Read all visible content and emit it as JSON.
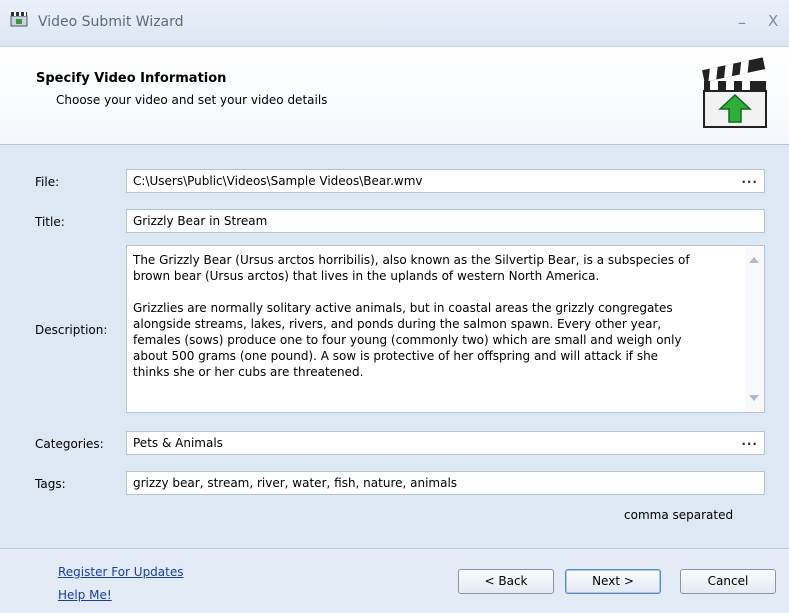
{
  "window": {
    "title": "Video Submit Wizard",
    "minimize": "–",
    "close": "X"
  },
  "header": {
    "title": "Specify Video Information",
    "subtitle": "Choose your video and set your video details"
  },
  "form": {
    "file": {
      "label": "File:",
      "value": "C:\\Users\\Public\\Videos\\Sample Videos\\Bear.wmv",
      "browse": "..."
    },
    "title": {
      "label": "Title:",
      "value": "Grizzly Bear in Stream"
    },
    "description": {
      "label": "Description:",
      "value": "The Grizzly Bear (Ursus arctos horribilis), also known as the Silvertip Bear, is a subspecies of\nbrown bear (Ursus arctos) that lives in the uplands of western North America.\n\nGrizzlies are normally solitary active animals, but in coastal areas the grizzly congregates\nalongside streams, lakes, rivers, and ponds during the salmon spawn. Every other year,\nfemales (sows) produce one to four young (commonly two) which are small and weigh only\nabout 500 grams (one pound). A sow is protective of her offspring and will attack if she\nthinks she or her cubs are threatened."
    },
    "categories": {
      "label": "Categories:",
      "value": "Pets & Animals",
      "browse": "..."
    },
    "tags": {
      "label": "Tags:",
      "value": "grizzy bear, stream, river, water, fish, nature, animals",
      "hint": "comma separated"
    }
  },
  "footer": {
    "register_link": "Register For Updates",
    "help_link": "Help Me!",
    "back_label": "< Back",
    "next_label": "Next >",
    "cancel_label": "Cancel"
  }
}
